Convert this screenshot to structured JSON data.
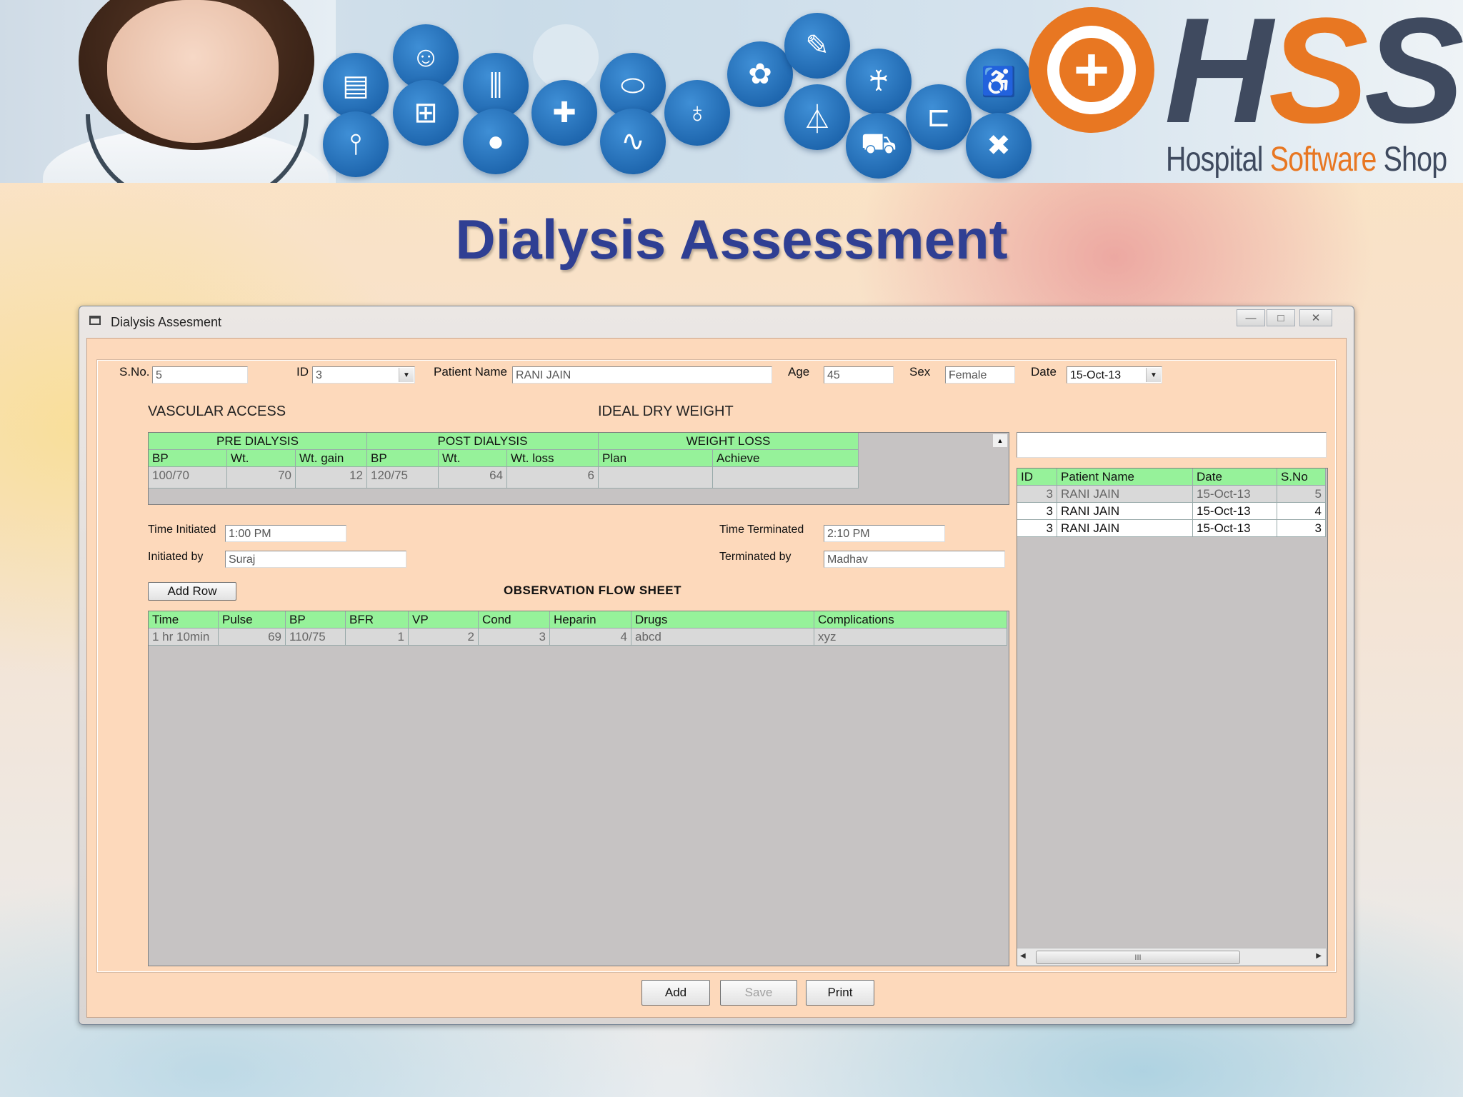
{
  "banner": {
    "logo_letters": [
      "H",
      "S",
      "S"
    ],
    "logo_sub_1": "Hospital ",
    "logo_sub_2": "Software",
    "logo_sub_3": " Shop",
    "accent_color": "#e87722",
    "brand_color": "#3f4a5f",
    "icons": [
      "clipboard-icon",
      "doctor-icon",
      "test-tubes-icon",
      "pills-icon",
      "brain-icon",
      "syringe-icon",
      "ribbon-icon",
      "wheelchair-icon",
      "thermometer-icon",
      "medicine-bottle-icon",
      "drops-icon",
      "first-aid-kit-icon",
      "stethoscope-icon",
      "microscope-icon",
      "flask-icon",
      "ambulance-icon",
      "hospital-bed-icon",
      "bandage-icon"
    ]
  },
  "page_title": "Dialysis Assessment",
  "window": {
    "title": "Dialysis Assesment",
    "buttons": {
      "minimize": "—",
      "maximize": "□",
      "close": "✕"
    }
  },
  "form": {
    "sno_label": "S.No.",
    "sno_value": "5",
    "id_label": "ID",
    "id_value": "3",
    "patient_name_label": "Patient Name",
    "patient_name_value": "RANI JAIN",
    "age_label": "Age",
    "age_value": "45",
    "sex_label": "Sex",
    "sex_value": "Female",
    "date_label": "Date",
    "date_value": "15-Oct-13",
    "vascular_access": "VASCULAR ACCESS",
    "ideal_dry_weight": "IDEAL DRY WEIGHT",
    "time_initiated_label": "Time Initiated",
    "time_initiated_value": "1:00 PM",
    "initiated_by_label": "Initiated by",
    "initiated_by_value": "Suraj",
    "time_terminated_label": "Time Terminated",
    "time_terminated_value": "2:10 PM",
    "terminated_by_label": "Terminated by",
    "terminated_by_value": "Madhav",
    "add_row": "Add Row",
    "observation_title": "OBSERVATION FLOW SHEET"
  },
  "dialysis_grid": {
    "groups": [
      "PRE DIALYSIS",
      "POST DIALYSIS",
      "WEIGHT LOSS"
    ],
    "columns": [
      "BP",
      "Wt.",
      "Wt. gain",
      "BP",
      "Wt.",
      "Wt. loss",
      "Plan",
      "Achieve"
    ],
    "rows": [
      [
        "100/70",
        "70",
        "12",
        "120/75",
        "64",
        "6",
        "",
        ""
      ]
    ],
    "scroll_up": "▲"
  },
  "observation_grid": {
    "columns": [
      "Time",
      "Pulse",
      "BP",
      "BFR",
      "VP",
      "Cond",
      "Heparin",
      "Drugs",
      "Complications"
    ],
    "rows": [
      [
        "1 hr 10min",
        "69",
        "110/75",
        "1",
        "2",
        "3",
        "4",
        "abcd",
        "xyz"
      ]
    ]
  },
  "patient_list": {
    "search_value": "",
    "columns": [
      "ID",
      "Patient Name",
      "Date",
      "S.No"
    ],
    "rows": [
      [
        "3",
        "RANI JAIN",
        "15-Oct-13",
        "5"
      ],
      [
        "3",
        "RANI JAIN",
        "15-Oct-13",
        "4"
      ],
      [
        "3",
        "RANI JAIN",
        "15-Oct-13",
        "3"
      ]
    ],
    "scroll_left": "◀",
    "scroll_right": "▶",
    "scroll_grip": "III"
  },
  "actions": {
    "add": "Add",
    "save": "Save",
    "print": "Print"
  }
}
